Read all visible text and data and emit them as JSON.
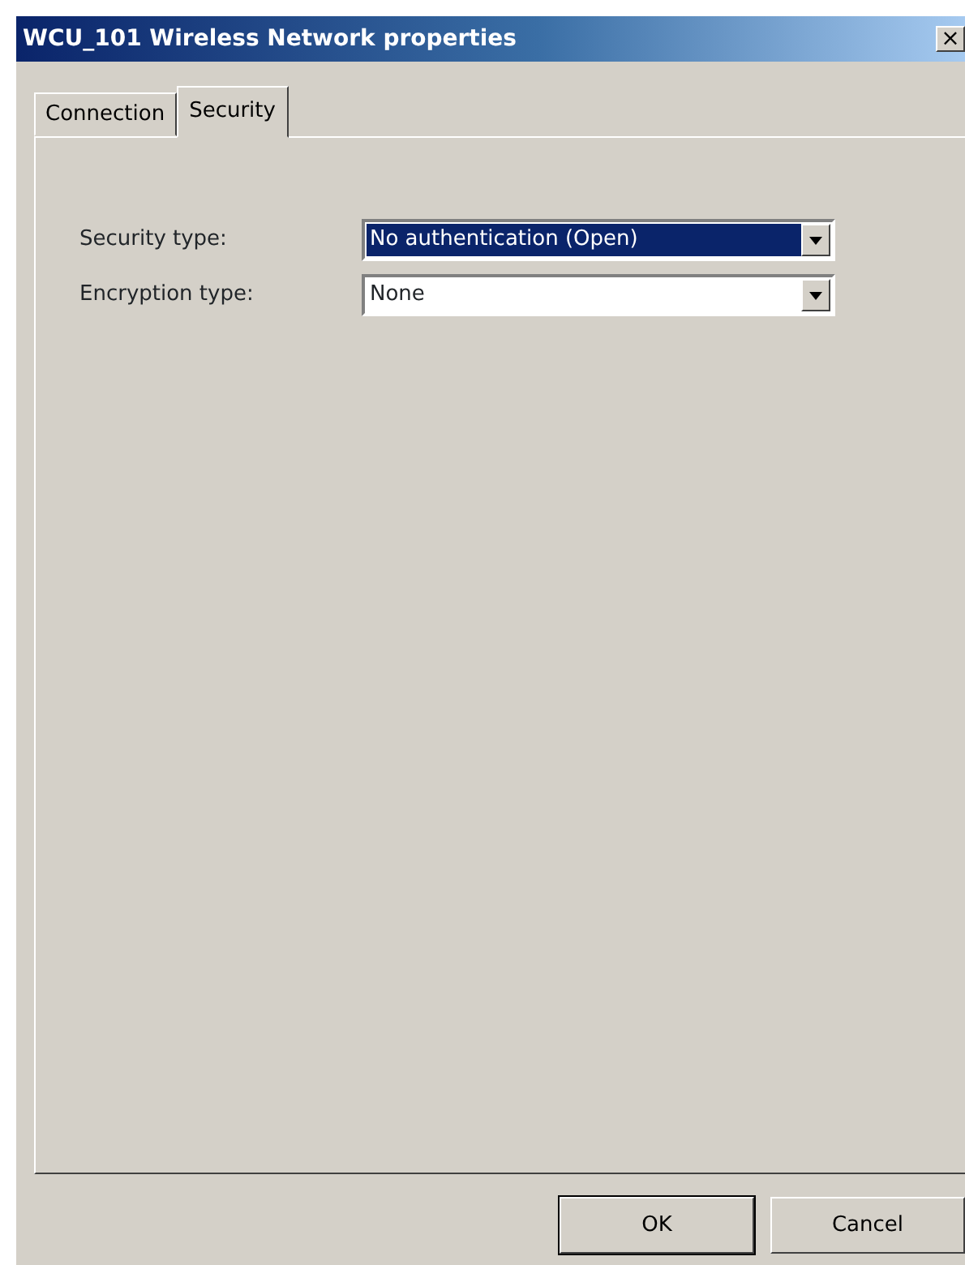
{
  "window": {
    "title": "WCU_101 Wireless Network properties",
    "close": "×"
  },
  "tabs": [
    {
      "label": "Connection",
      "selected": false
    },
    {
      "label": "Security",
      "selected": true
    }
  ],
  "fields": [
    {
      "label": "Security type:",
      "value": "No authentication (Open)",
      "highlighted": true
    },
    {
      "label": "Encryption type:",
      "value": "None",
      "highlighted": false
    }
  ],
  "buttons": [
    {
      "label": "OK",
      "default": true
    },
    {
      "label": "Cancel",
      "default": false
    }
  ]
}
